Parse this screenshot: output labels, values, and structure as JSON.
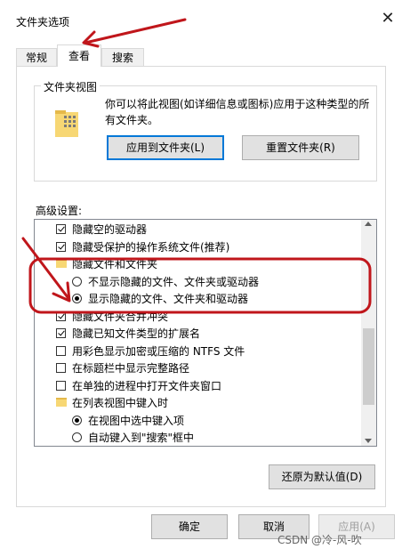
{
  "window": {
    "title": "文件夹选项",
    "close_symbol": "✕"
  },
  "tabs": [
    {
      "label": "常规",
      "active": false
    },
    {
      "label": "查看",
      "active": true
    },
    {
      "label": "搜索",
      "active": false
    }
  ],
  "folder_views": {
    "legend": "文件夹视图",
    "description": "你可以将此视图(如详细信息或图标)应用于这种类型的所有文件夹。",
    "apply_button": "应用到文件夹(L)",
    "reset_button": "重置文件夹(R)"
  },
  "advanced": {
    "label": "高级设置:",
    "items": [
      {
        "type": "checkbox",
        "checked": true,
        "label": "隐藏空的驱动器"
      },
      {
        "type": "checkbox",
        "checked": true,
        "label": "隐藏受保护的操作系统文件(推荐)"
      },
      {
        "type": "folder",
        "label": "隐藏文件和文件夹"
      },
      {
        "type": "radio",
        "checked": false,
        "label": "不显示隐藏的文件、文件夹或驱动器"
      },
      {
        "type": "radio",
        "checked": true,
        "label": "显示隐藏的文件、文件夹和驱动器"
      },
      {
        "type": "checkbox",
        "checked": true,
        "label": "隐藏文件夹合并冲突"
      },
      {
        "type": "checkbox",
        "checked": true,
        "label": "隐藏已知文件类型的扩展名"
      },
      {
        "type": "checkbox",
        "checked": false,
        "label": "用彩色显示加密或压缩的 NTFS 文件"
      },
      {
        "type": "checkbox",
        "checked": false,
        "label": "在标题栏中显示完整路径"
      },
      {
        "type": "checkbox",
        "checked": false,
        "label": "在单独的进程中打开文件夹窗口"
      },
      {
        "type": "folder",
        "label": "在列表视图中键入时"
      },
      {
        "type": "radio",
        "checked": true,
        "label": "在视图中选中键入项"
      },
      {
        "type": "radio",
        "checked": false,
        "label": "自动键入到\"搜索\"框中"
      }
    ],
    "restore_button": "还原为默认值(D)"
  },
  "footer": {
    "ok": "确定",
    "cancel": "取消",
    "apply": "应用(A)"
  },
  "watermark": "CSDN @冷-风-吹",
  "colors": {
    "annotation_red": "#c0161b",
    "focus_blue": "#0078d7"
  }
}
